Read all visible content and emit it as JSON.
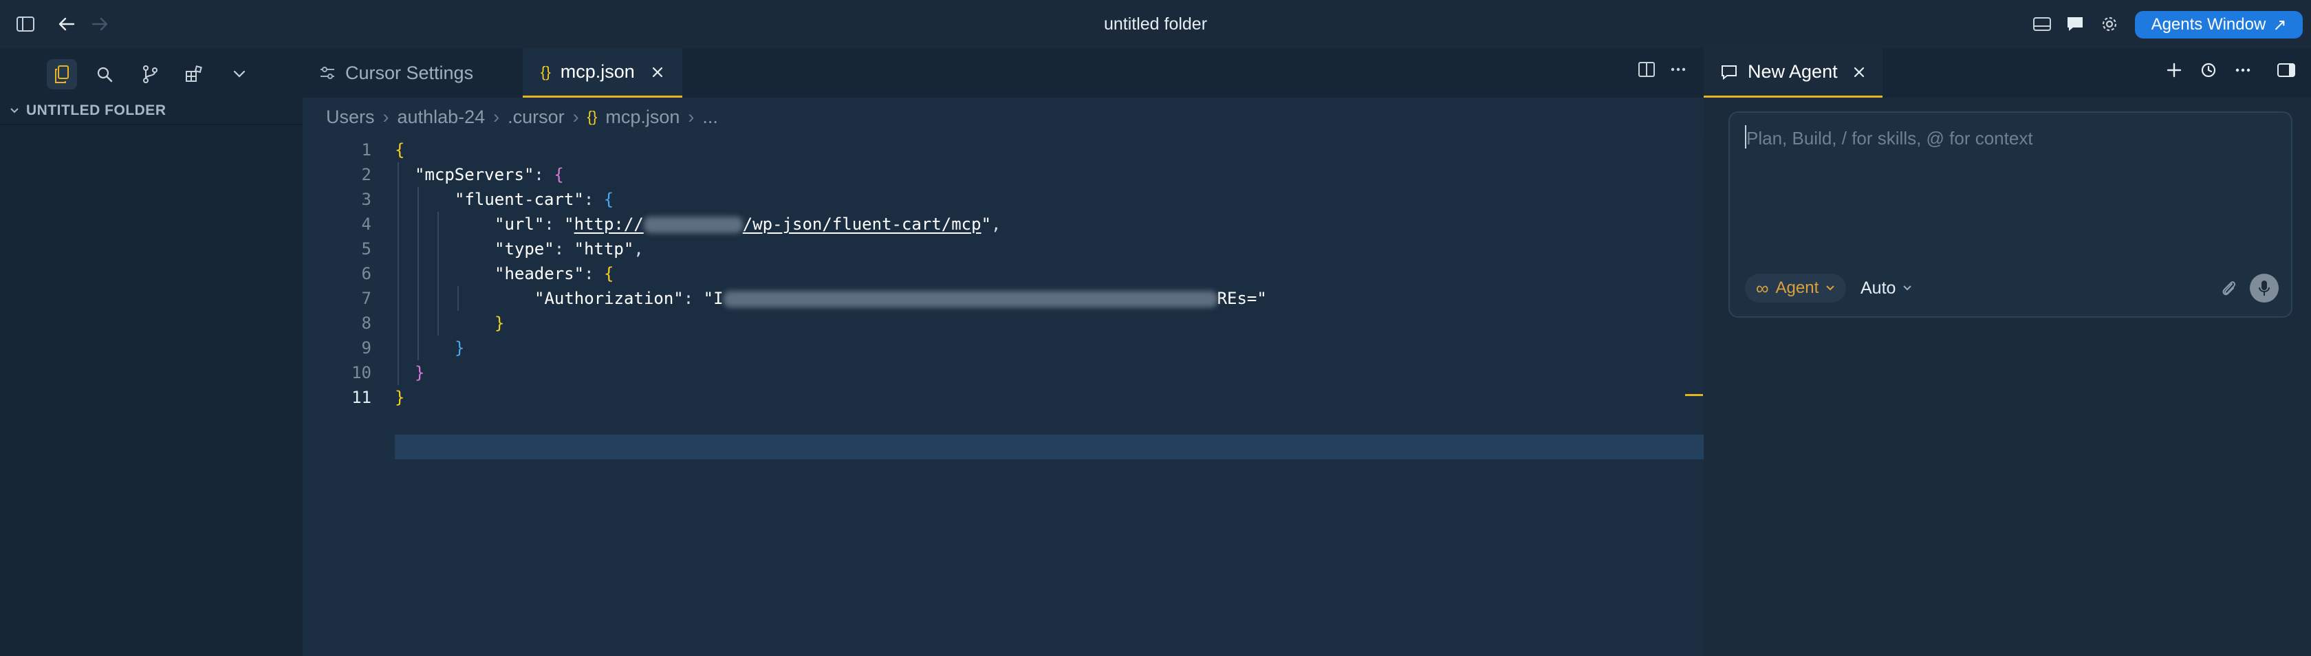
{
  "window": {
    "title": "untitled folder"
  },
  "header": {
    "agents_window_label": "Agents Window",
    "agents_window_arrow": "↗"
  },
  "sidebar": {
    "folder_label": "UNTITLED FOLDER"
  },
  "editor": {
    "tabs": [
      {
        "label": "Cursor Settings",
        "icon": "sliders-icon"
      },
      {
        "label": "mcp.json",
        "icon": "json-braces-icon",
        "icon_text": "{}"
      }
    ],
    "breadcrumb": {
      "items": [
        "Users",
        "authlab-24",
        ".cursor",
        "mcp.json",
        "..."
      ],
      "json_icon_text": "{}",
      "separator": "›"
    },
    "line_numbers": [
      "1",
      "2",
      "3",
      "4",
      "5",
      "6",
      "7",
      "8",
      "9",
      "10",
      "11"
    ],
    "code": {
      "open_brace": "{",
      "close_brace": "}",
      "quote": "\"",
      "colon_space": ": ",
      "comma": ",",
      "key_mcp_servers": "mcpServers",
      "key_fluent_cart": "fluent-cart",
      "key_url": "url",
      "url_prefix": "http://",
      "url_suffix": "/wp-json/fluent-cart/mcp",
      "key_type": "type",
      "value_type": "http",
      "key_headers": "headers",
      "key_authorization": "Authorization",
      "auth_prefix": "I",
      "auth_suffix": "REs="
    }
  },
  "agent": {
    "tab_label": "New Agent",
    "composer_placeholder": "Plan, Build, / for skills, @ for context",
    "mode_label": "Agent",
    "mode_icon_text": "∞",
    "model_label": "Auto"
  },
  "colors": {
    "accent_yellow": "#e6b422",
    "agents_button": "#1f7ae0",
    "bracket_yellow": "#f2cf24",
    "bracket_purple": "#d879d6",
    "bracket_blue": "#4aa8f0"
  }
}
